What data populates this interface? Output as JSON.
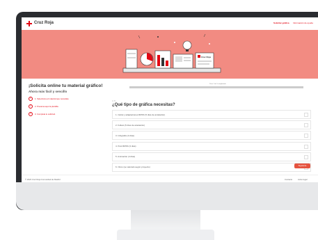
{
  "header": {
    "logo_text": "Cruz Roja",
    "nav": [
      "Solicitar gráfica",
      "Información de ayuda"
    ]
  },
  "intro": {
    "title": "¡Solicita online tu material gráfico!",
    "subtitle": "Ahora más fácil y sencillo",
    "steps": [
      {
        "num": "1",
        "label": "1. Selecciona el material que necesitas."
      },
      {
        "num": "2",
        "label": "2. Presiona aquí la plantilla."
      },
      {
        "num": "3",
        "label": "3. Completa tu solicitud."
      }
    ]
  },
  "form": {
    "progress_label": "Paso 1 de 5 completado",
    "step_count": "1 / 5",
    "question": "¿Qué tipo de gráfica necesitas?",
    "options": [
      "1. Cartel y adaptaciones RRSS (5 días de antelación)",
      "2. Folleto (5 días de antelación)",
      "3. Infografía (4 días)",
      "4. Post RRSS (3 días)",
      "5. Animación (4 días)",
      "6. Otros (se valorará según proyecto)"
    ],
    "continue_label": "Siguiente"
  },
  "footer": {
    "copyright": "© 2023 Cruz Roja Comunidad de Madrid",
    "links": [
      "Contacto",
      "Aviso legal"
    ]
  },
  "colors": {
    "brand": "#e30613",
    "hero": "#f28b82"
  }
}
